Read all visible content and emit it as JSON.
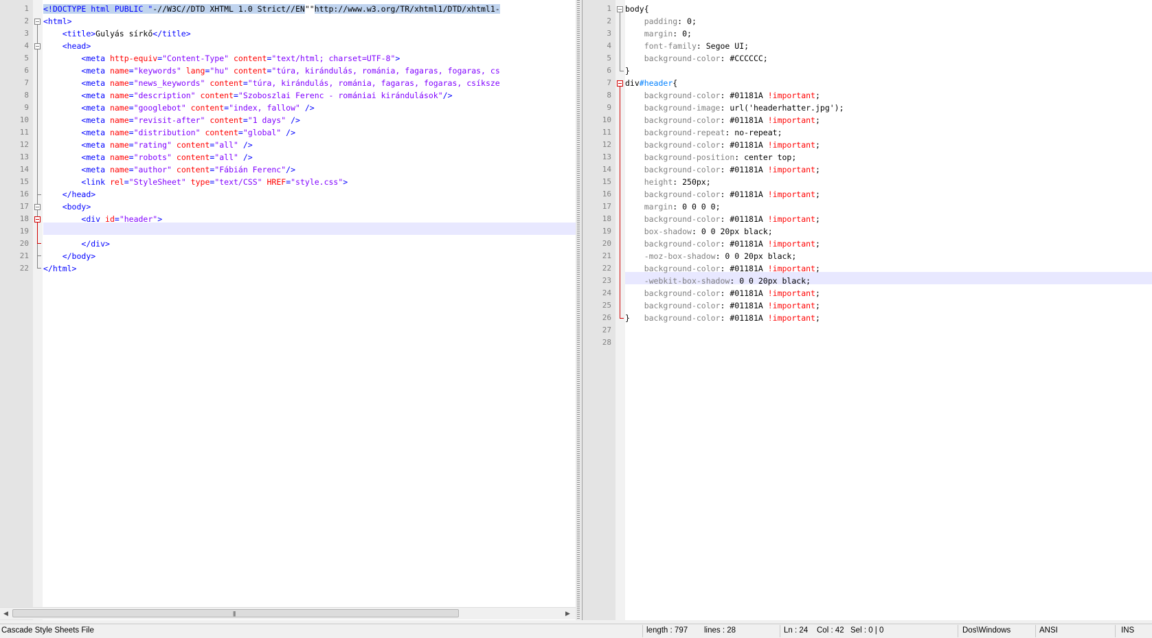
{
  "left_editor": {
    "line_numbers": [
      "1",
      "2",
      "3",
      "4",
      "5",
      "6",
      "7",
      "8",
      "9",
      "10",
      "11",
      "12",
      "13",
      "14",
      "15",
      "16",
      "17",
      "18",
      "19",
      "20",
      "21",
      "22"
    ],
    "doctype": {
      "start": "<!DOCTYPE html PUBLIC \"",
      "sel1": "-//W3C//DTD XHTML 1.0 Strict//EN",
      "mid": "\"\"",
      "sel2": "http://www.w3.org/TR/xhtml1/DTD/xhtml1-"
    },
    "lines": {
      "l2": "<html>",
      "l3_open": "<title>",
      "l3_text": "Gulyás sírkő",
      "l3_close": "</title>",
      "l4": "<head>",
      "l5": [
        "<meta ",
        "http-equiv",
        "=",
        "\"Content-Type\"",
        " content",
        "=",
        "\"text/html; charset=UTF-8\"",
        ">"
      ],
      "l6": [
        "<meta ",
        "name",
        "=",
        "\"keywords\"",
        " lang",
        "=",
        "\"hu\"",
        " content",
        "=",
        "\"túra, kirándulás, románia, fagaras, fogaras, cs"
      ],
      "l7": [
        "<meta ",
        "name",
        "=",
        "\"news_keywords\"",
        " content",
        "=",
        "\"túra, kirándulás, románia, fagaras, fogaras, csíksze"
      ],
      "l8": [
        "<meta ",
        "name",
        "=",
        "\"description\"",
        " content",
        "=",
        "\"Szoboszlai Ferenc - romániai kirándulások\"",
        "/>"
      ],
      "l9": [
        "<meta ",
        "name",
        "=",
        "\"googlebot\"",
        " content",
        "=",
        "\"index, fallow\"",
        " />"
      ],
      "l10": [
        "<meta ",
        "name",
        "=",
        "\"revisit-after\"",
        " content",
        "=",
        "\"1 days\"",
        " />"
      ],
      "l11": [
        "<meta ",
        "name",
        "=",
        "\"distribution\"",
        " content",
        "=",
        "\"global\"",
        " />"
      ],
      "l12": [
        "<meta ",
        "name",
        "=",
        "\"rating\"",
        " content",
        "=",
        "\"all\"",
        " />"
      ],
      "l13": [
        "<meta ",
        "name",
        "=",
        "\"robots\"",
        " content",
        "=",
        "\"all\"",
        " />"
      ],
      "l14": [
        "<meta ",
        "name",
        "=",
        "\"author\"",
        " content",
        "=",
        "\"Fábián Ferenc\"",
        "/>"
      ],
      "l15": [
        "<link ",
        "rel",
        "=",
        "\"StyleSheet\"",
        " type",
        "=",
        "\"text/CSS\"",
        " HREF",
        "=",
        "\"style.css\"",
        ">"
      ],
      "l16": "</head>",
      "l17": "<body>",
      "l18": [
        "<div ",
        "id",
        "=",
        "\"header\"",
        ">"
      ],
      "l20": "</div>",
      "l21": "</body>",
      "l22": "</html>"
    }
  },
  "right_editor": {
    "line_numbers": [
      "1",
      "2",
      "3",
      "4",
      "5",
      "6",
      "7",
      "8",
      "9",
      "10",
      "11",
      "12",
      "13",
      "14",
      "15",
      "16",
      "17",
      "18",
      "19",
      "20",
      "21",
      "22",
      "23",
      "24",
      "25",
      "26",
      "27",
      "28"
    ],
    "body_selector": "body",
    "open_brace": "{",
    "close_brace": "}",
    "body_props": [
      {
        "prop": "padding",
        "value": "0;"
      },
      {
        "prop": "margin",
        "value": "0;"
      },
      {
        "prop": "font-family",
        "value": "Segoe UI;"
      },
      {
        "prop": "background-color",
        "value": "#CCCCCC;"
      }
    ],
    "header_selector_tag": "div",
    "header_selector_id": "#header",
    "header_props": [
      {
        "prop": "background-color",
        "value": "#01181A ",
        "imp": "!important",
        "end": ";"
      },
      {
        "prop": "background-image",
        "value": "url('headerhatter.jpg');",
        "imp": "",
        "end": ""
      },
      {
        "prop": "background-color",
        "value": "#01181A ",
        "imp": "!important",
        "end": ";"
      },
      {
        "prop": "background-repeat",
        "value": "no-repeat;",
        "imp": "",
        "end": ""
      },
      {
        "prop": "background-color",
        "value": "#01181A ",
        "imp": "!important",
        "end": ";"
      },
      {
        "prop": "background-position",
        "value": "center top;",
        "imp": "",
        "end": ""
      },
      {
        "prop": "background-color",
        "value": "#01181A ",
        "imp": "!important",
        "end": ";"
      },
      {
        "prop": "height",
        "value": "250px;",
        "imp": "",
        "end": ""
      },
      {
        "prop": "background-color",
        "value": "#01181A ",
        "imp": "!important",
        "end": ";"
      },
      {
        "prop": "margin",
        "value": "0 0 0 0;",
        "imp": "",
        "end": ""
      },
      {
        "prop": "background-color",
        "value": "#01181A ",
        "imp": "!important",
        "end": ";"
      },
      {
        "prop": "box-shadow",
        "value": "0 0 20px black;",
        "imp": "",
        "end": ""
      },
      {
        "prop": "background-color",
        "value": "#01181A ",
        "imp": "!important",
        "end": ";"
      },
      {
        "prop": "-moz-box-shadow",
        "value": "0 0 20px black;",
        "imp": "",
        "end": ""
      },
      {
        "prop": "background-color",
        "value": "#01181A ",
        "imp": "!important",
        "end": ";"
      },
      {
        "prop": "-webkit-box-shadow",
        "value": "0 0 20px black;",
        "imp": "",
        "end": ""
      },
      {
        "prop": "background-color",
        "value": "#01181A ",
        "imp": "!important",
        "end": ";"
      },
      {
        "prop": "background-color",
        "value": "#01181A ",
        "imp": "!important",
        "end": ";"
      },
      {
        "prop": "background-color",
        "value": "#01181A ",
        "imp": "!important",
        "end": ";"
      }
    ]
  },
  "status_bar": {
    "file_type": "Cascade Style Sheets File",
    "length": "length : 797",
    "lines": "lines : 28",
    "ln": "Ln : 24",
    "col": "Col : 42",
    "sel": "Sel : 0 | 0",
    "eol": "Dos\\Windows",
    "encoding": "ANSI",
    "mode": "INS"
  },
  "colors": {
    "tag": "#0000ff",
    "attribute": "#ff0000",
    "value": "#8000ff",
    "property": "#808080",
    "important": "#ff0000",
    "id_selector": "#0080ff",
    "current_line": "#e8e8ff",
    "selection": "#c0d4ef"
  }
}
